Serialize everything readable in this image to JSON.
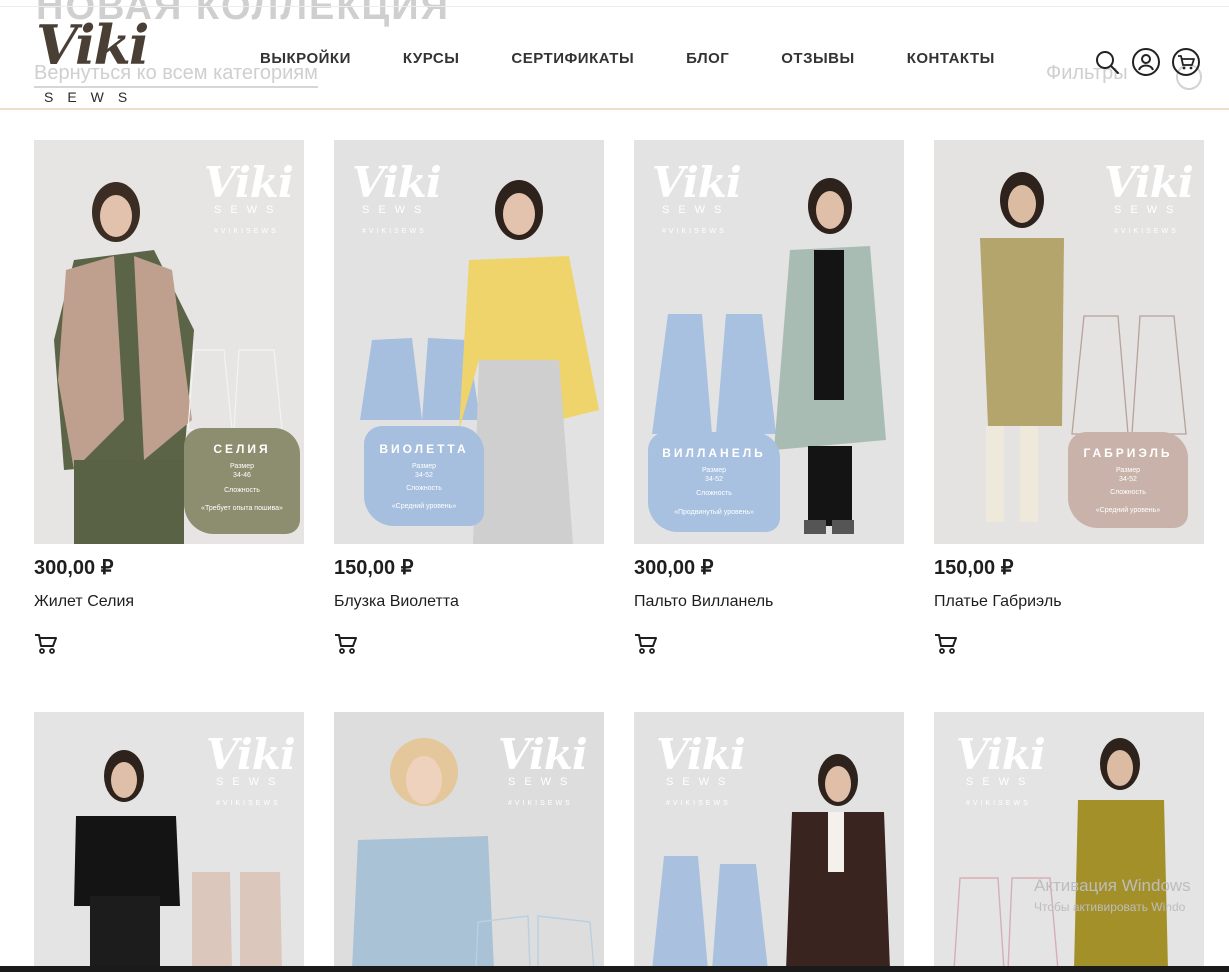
{
  "ghost": {
    "title": "НОВАЯ КОЛЛЕКЦИЯ",
    "back_link": "Вернуться ко всем категориям",
    "filters": "Фильтры"
  },
  "header": {
    "logo_text": "Viki",
    "logo_sub": "SEWS",
    "nav": [
      "ВЫКРОЙКИ",
      "КУРСЫ",
      "СЕРТИФИКАТЫ",
      "БЛОГ",
      "ОТЗЫВЫ",
      "КОНТАКТЫ"
    ],
    "icons": [
      "search-icon",
      "account-icon",
      "cart-icon"
    ]
  },
  "brand_mark": {
    "viki": "Viki",
    "sews": "SEWS",
    "hashtag": "#VIKISEWS"
  },
  "products": [
    {
      "price": "300,00 ₽",
      "name": "Жилет Селия",
      "badge_title": "СЕЛИЯ",
      "badge_size_label": "Размер",
      "badge_size": "34-46",
      "badge_level_label": "Сложность",
      "badge_level": "«Требует опыта пошива»",
      "bg": "#e6e5e3",
      "badge_color": "#8c8e6f"
    },
    {
      "price": "150,00 ₽",
      "name": "Блузка Виолетта",
      "badge_title": "ВИОЛЕТТА",
      "badge_size_label": "Размер",
      "badge_size": "34-52",
      "badge_level_label": "Сложность",
      "badge_level": "«Средний уровень»",
      "bg": "#e2e2e2",
      "badge_color": "#a6bfdf"
    },
    {
      "price": "300,00 ₽",
      "name": "Пальто Вилланель",
      "badge_title": "ВИЛЛАНЕЛЬ",
      "badge_size_label": "Размер",
      "badge_size": "34-52",
      "badge_level_label": "Сложность",
      "badge_level": "«Продвинутый уровень»",
      "bg": "#e3e3e3",
      "badge_color": "#a8c1e0"
    },
    {
      "price": "150,00 ₽",
      "name": "Платье Габриэль",
      "badge_title": "ГАБРИЭЛЬ",
      "badge_size_label": "Размер",
      "badge_size": "34-52",
      "badge_level_label": "Сложность",
      "badge_level": "«Средний уровень»",
      "bg": "#e4e3e2",
      "badge_color": "#c9b2aa"
    },
    {
      "bg": "#e4e4e4"
    },
    {
      "bg": "#dedddd"
    },
    {
      "bg": "#e2e2e2"
    },
    {
      "bg": "#e4e4e4"
    }
  ],
  "watermark": {
    "line1": "Активация Windows",
    "line2": "Чтобы активировать Windo"
  },
  "colors": {
    "accent_line": "#f3dcc7",
    "logo": "#4a3f35",
    "text": "#1e1e1e"
  }
}
